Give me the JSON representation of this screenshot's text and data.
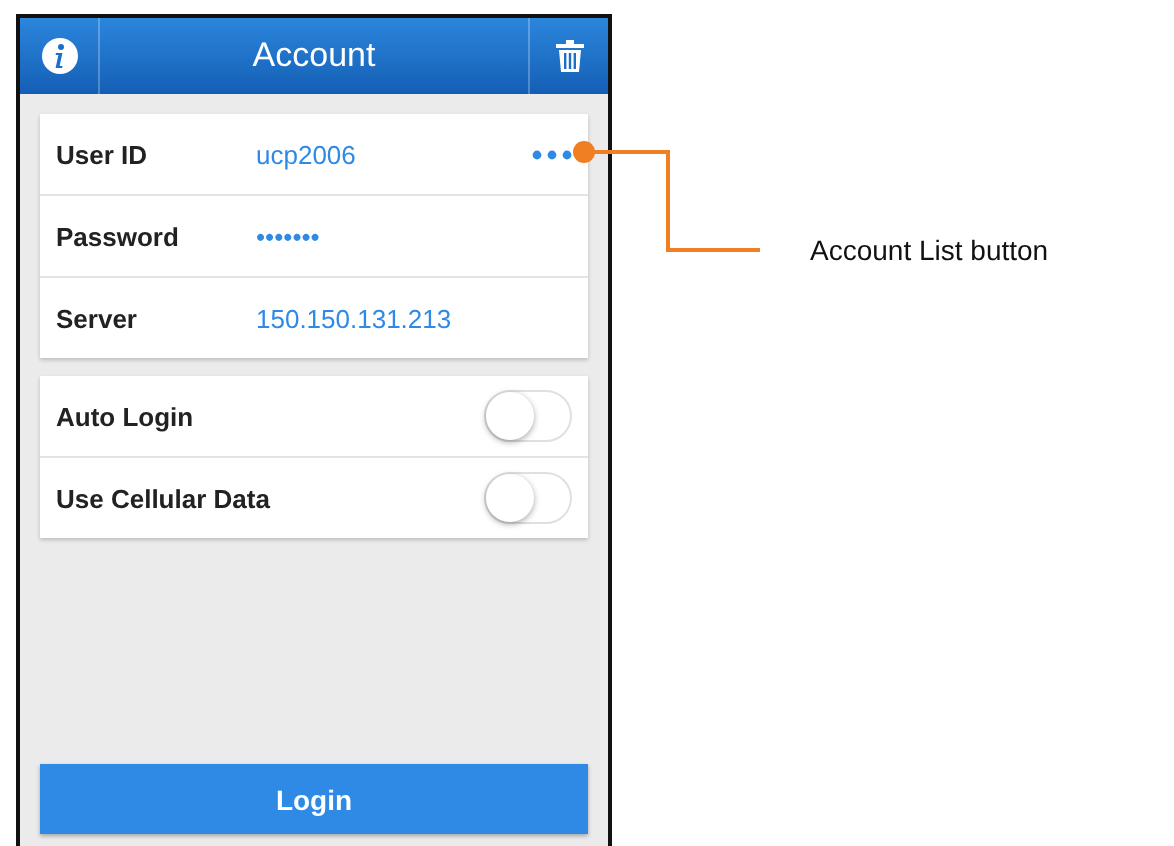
{
  "header": {
    "title": "Account"
  },
  "account_fields": [
    {
      "label": "User ID",
      "value": "ucp2006",
      "has_menu": true
    },
    {
      "label": "Password",
      "value": "•••••••",
      "has_menu": false
    },
    {
      "label": "Server",
      "value": "150.150.131.213",
      "has_menu": false
    }
  ],
  "settings": [
    {
      "label": "Auto Login",
      "on": false
    },
    {
      "label": "Use Cellular Data",
      "on": false
    }
  ],
  "login_button": "Login",
  "callout": {
    "label": "Account List button"
  }
}
